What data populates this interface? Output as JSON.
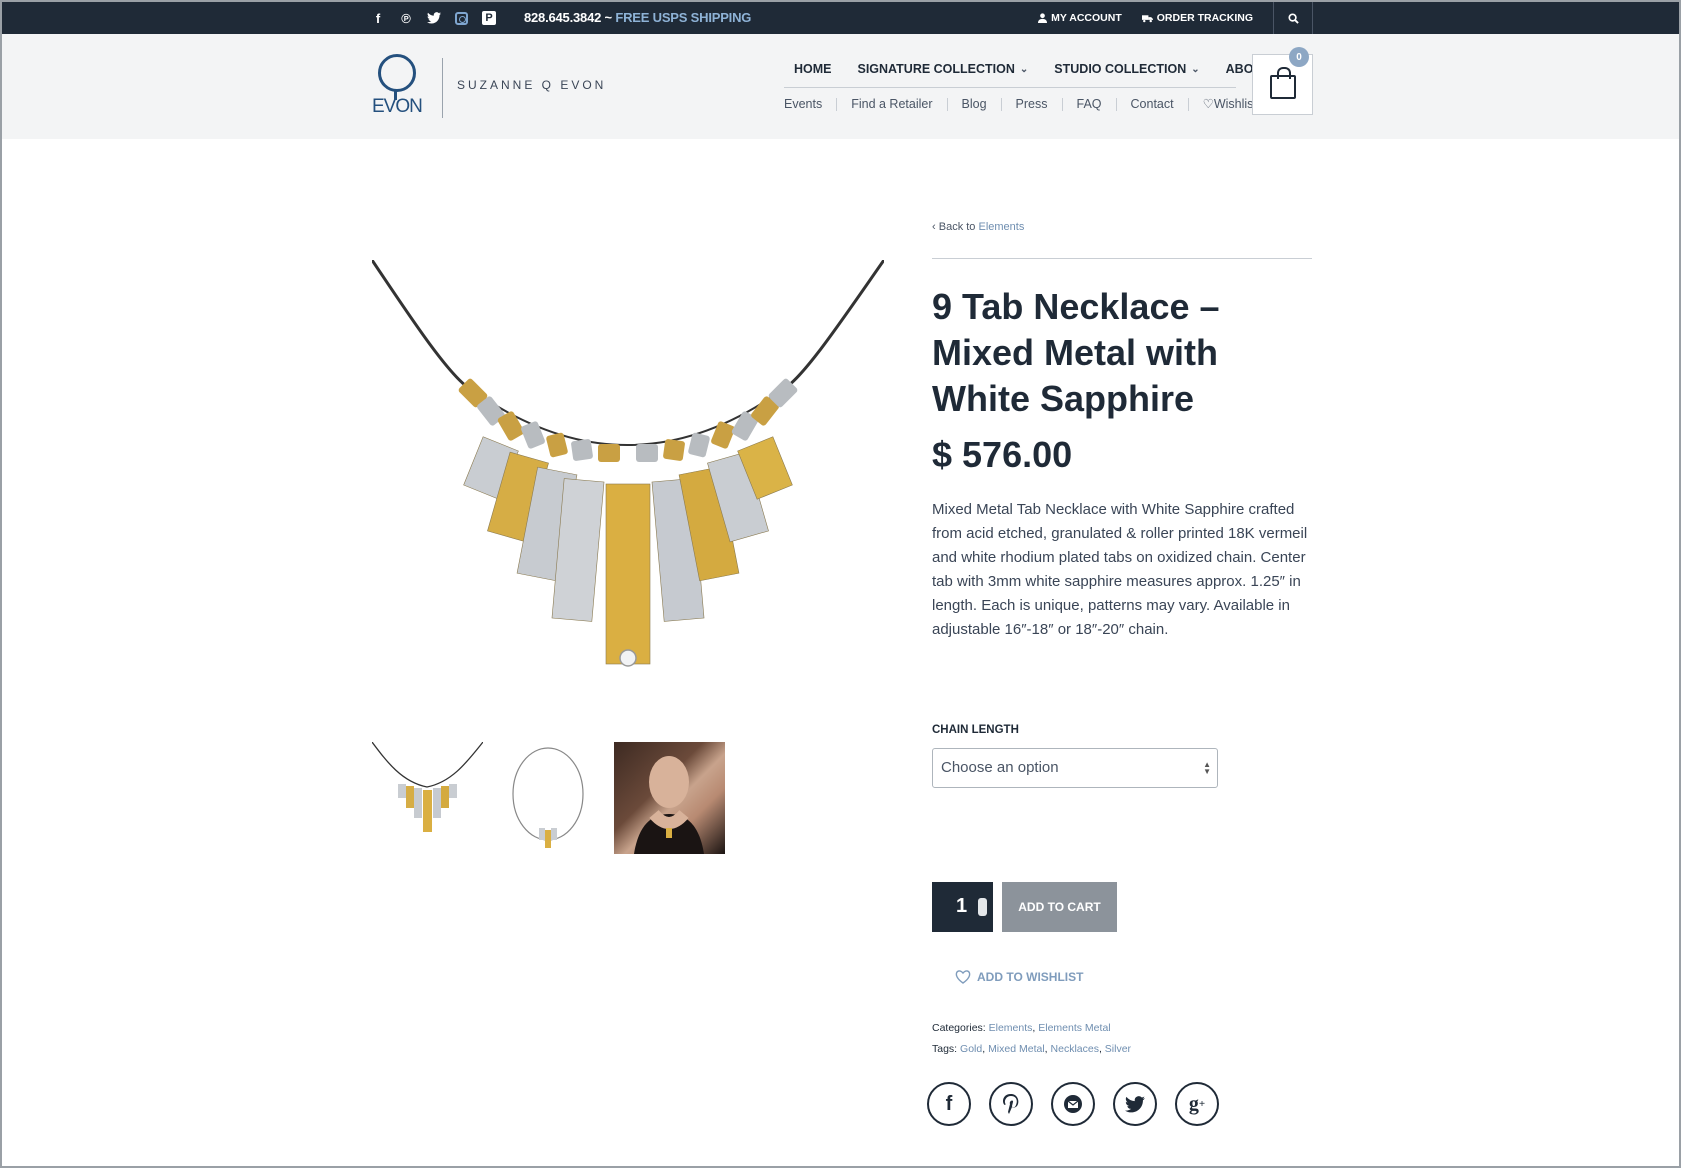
{
  "topbar": {
    "phone": "828.645.3842 ~",
    "shipping": "FREE USPS SHIPPING",
    "my_account": "MY ACCOUNT",
    "order_tracking": "ORDER TRACKING",
    "social_icons": [
      "facebook-icon",
      "pinterest-icon",
      "twitter-icon",
      "instagram-icon",
      "pinterest-board-icon"
    ]
  },
  "header": {
    "logo_text": "EVON",
    "brand_name": "SUZANNE Q EVON",
    "main_nav": [
      {
        "label": "HOME"
      },
      {
        "label": "SIGNATURE COLLECTION",
        "chevron": "⌄"
      },
      {
        "label": "STUDIO COLLECTION",
        "chevron": "⌄"
      },
      {
        "label": "ABOUT"
      }
    ],
    "sub_nav": [
      "Events",
      "Find a Retailer",
      "Blog",
      "Press",
      "FAQ",
      "Contact",
      "Wishlist"
    ],
    "cart_count": "0"
  },
  "product": {
    "back_prefix": "Back to",
    "back_link": "Elements",
    "title": "9 Tab Necklace – Mixed Metal with White Sapphire",
    "price": "$ 576.00",
    "description": "Mixed Metal Tab Necklace with White Sapphire crafted from acid etched, granulated & roller printed 18K vermeil and white rhodium plated tabs on oxidized chain. Center tab with 3mm white sapphire measures approx. 1.25″ in length. Each is unique, patterns may vary. Available in adjustable 16″-18″ or 18″-20″ chain.",
    "chain_length_label": "CHAIN LENGTH",
    "chain_select_value": "Choose an option",
    "quantity": "1",
    "add_to_cart": "ADD TO CART",
    "add_to_wishlist": "ADD TO WISHLIST",
    "categories_label": "Categories:",
    "categories": [
      "Elements",
      "Elements Metal"
    ],
    "tags_label": "Tags:",
    "tags": [
      "Gold",
      "Mixed Metal",
      "Necklaces",
      "Silver"
    ],
    "share_icons": [
      "facebook-share-icon",
      "pinterest-share-icon",
      "email-share-icon",
      "twitter-share-icon",
      "google-plus-share-icon"
    ]
  },
  "colors": {
    "navy": "#1f2a37",
    "link_blue": "#6f8eb0",
    "gold": "#d8ab3c",
    "silver": "#c4c8cc"
  }
}
